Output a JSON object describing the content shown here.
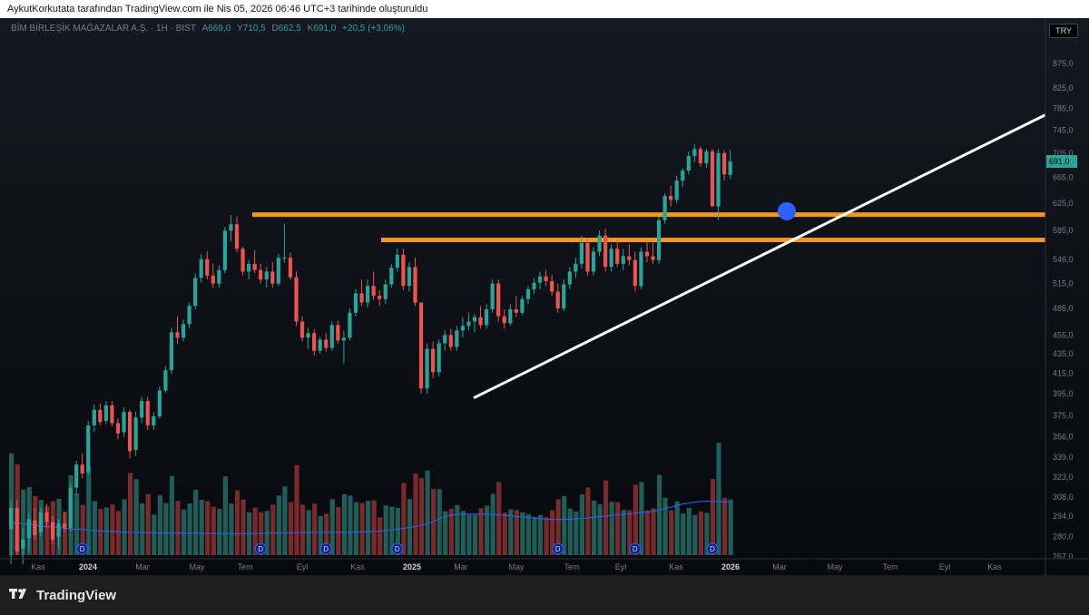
{
  "header": {
    "attribution": "AykutKorkutata tarafından TradingView.com ile Nis 05, 2026 06:46 UTC+3 tarihinde oluşturuldu"
  },
  "legend": {
    "symbol": "BİM BİRLEŞİK MAĞAZALAR A.Ş. · 1H · BIST",
    "a_label": "A",
    "a_value": "669,0",
    "y_label": "Y",
    "y_value": "710,5",
    "d_label": "D",
    "d_value": "662,5",
    "k_label": "K",
    "k_value": "691,0",
    "change": "+20,5 (+3,06%)"
  },
  "currency_badge": "TRY",
  "footer": {
    "brand": "TradingView",
    "logo_icon": "tradingview-logo-icon"
  },
  "chart_data": {
    "type": "candlestick",
    "scale": "log",
    "ylim": [
      262,
      900
    ],
    "price_ticks": [
      "875,0",
      "825,0",
      "785,0",
      "745,0",
      "705,0",
      "665,0",
      "625,0",
      "585,0",
      "546,0",
      "515,0",
      "485,0",
      "455,0",
      "435,0",
      "415,0",
      "395,0",
      "375,0",
      "356,0",
      "339,0",
      "323,0",
      "308,0",
      "294,0",
      "280,0",
      "267,0"
    ],
    "last_price_label": "691,0",
    "x_ticks": [
      "Kas",
      "2024",
      "Mar",
      "May",
      "Tem",
      "Eyl",
      "Kas",
      "2025",
      "Mar",
      "May",
      "Tem",
      "Eyl",
      "Kas",
      "2026",
      "Mar",
      "May",
      "Tem",
      "Eyl",
      "Kas"
    ],
    "candles": [
      {
        "o": 285,
        "h": 305,
        "l": 262,
        "c": 300
      },
      {
        "o": 300,
        "h": 306,
        "l": 268,
        "c": 270
      },
      {
        "o": 272,
        "h": 286,
        "l": 262,
        "c": 278
      },
      {
        "o": 279,
        "h": 296,
        "l": 270,
        "c": 292
      },
      {
        "o": 291,
        "h": 300,
        "l": 278,
        "c": 281
      },
      {
        "o": 283,
        "h": 300,
        "l": 280,
        "c": 297
      },
      {
        "o": 297,
        "h": 303,
        "l": 286,
        "c": 290
      },
      {
        "o": 290,
        "h": 294,
        "l": 275,
        "c": 278
      },
      {
        "o": 280,
        "h": 292,
        "l": 272,
        "c": 289
      },
      {
        "o": 289,
        "h": 297,
        "l": 283,
        "c": 286
      },
      {
        "o": 286,
        "h": 318,
        "l": 284,
        "c": 315
      },
      {
        "o": 315,
        "h": 336,
        "l": 310,
        "c": 333
      },
      {
        "o": 333,
        "h": 342,
        "l": 322,
        "c": 326
      },
      {
        "o": 327,
        "h": 370,
        "l": 325,
        "c": 366
      },
      {
        "o": 366,
        "h": 385,
        "l": 360,
        "c": 380
      },
      {
        "o": 380,
        "h": 386,
        "l": 366,
        "c": 369
      },
      {
        "o": 370,
        "h": 388,
        "l": 367,
        "c": 384
      },
      {
        "o": 384,
        "h": 388,
        "l": 365,
        "c": 368
      },
      {
        "o": 368,
        "h": 372,
        "l": 354,
        "c": 359
      },
      {
        "o": 360,
        "h": 382,
        "l": 356,
        "c": 378
      },
      {
        "o": 378,
        "h": 380,
        "l": 338,
        "c": 344
      },
      {
        "o": 345,
        "h": 378,
        "l": 340,
        "c": 373
      },
      {
        "o": 373,
        "h": 392,
        "l": 368,
        "c": 388
      },
      {
        "o": 388,
        "h": 392,
        "l": 362,
        "c": 366
      },
      {
        "o": 366,
        "h": 378,
        "l": 362,
        "c": 374
      },
      {
        "o": 374,
        "h": 402,
        "l": 372,
        "c": 398
      },
      {
        "o": 398,
        "h": 422,
        "l": 396,
        "c": 418
      },
      {
        "o": 418,
        "h": 463,
        "l": 414,
        "c": 458
      },
      {
        "o": 458,
        "h": 476,
        "l": 445,
        "c": 452
      },
      {
        "o": 452,
        "h": 472,
        "l": 448,
        "c": 467
      },
      {
        "o": 467,
        "h": 492,
        "l": 462,
        "c": 488
      },
      {
        "o": 488,
        "h": 528,
        "l": 484,
        "c": 522
      },
      {
        "o": 522,
        "h": 553,
        "l": 516,
        "c": 546
      },
      {
        "o": 546,
        "h": 556,
        "l": 520,
        "c": 525
      },
      {
        "o": 525,
        "h": 540,
        "l": 510,
        "c": 515
      },
      {
        "o": 515,
        "h": 538,
        "l": 510,
        "c": 532
      },
      {
        "o": 532,
        "h": 590,
        "l": 528,
        "c": 585
      },
      {
        "o": 585,
        "h": 607,
        "l": 570,
        "c": 594
      },
      {
        "o": 594,
        "h": 605,
        "l": 555,
        "c": 560
      },
      {
        "o": 560,
        "h": 563,
        "l": 525,
        "c": 530
      },
      {
        "o": 530,
        "h": 545,
        "l": 520,
        "c": 540
      },
      {
        "o": 540,
        "h": 558,
        "l": 528,
        "c": 532
      },
      {
        "o": 532,
        "h": 540,
        "l": 515,
        "c": 520
      },
      {
        "o": 520,
        "h": 536,
        "l": 510,
        "c": 530
      },
      {
        "o": 530,
        "h": 542,
        "l": 510,
        "c": 515
      },
      {
        "o": 515,
        "h": 553,
        "l": 512,
        "c": 548
      },
      {
        "o": 548,
        "h": 595,
        "l": 542,
        "c": 548
      },
      {
        "o": 548,
        "h": 555,
        "l": 520,
        "c": 523
      },
      {
        "o": 523,
        "h": 530,
        "l": 465,
        "c": 470
      },
      {
        "o": 470,
        "h": 476,
        "l": 448,
        "c": 452
      },
      {
        "o": 452,
        "h": 463,
        "l": 440,
        "c": 457
      },
      {
        "o": 457,
        "h": 461,
        "l": 433,
        "c": 438
      },
      {
        "o": 438,
        "h": 453,
        "l": 435,
        "c": 450
      },
      {
        "o": 450,
        "h": 457,
        "l": 437,
        "c": 441
      },
      {
        "o": 441,
        "h": 470,
        "l": 438,
        "c": 466
      },
      {
        "o": 466,
        "h": 471,
        "l": 445,
        "c": 449
      },
      {
        "o": 449,
        "h": 460,
        "l": 425,
        "c": 452
      },
      {
        "o": 452,
        "h": 485,
        "l": 449,
        "c": 480
      },
      {
        "o": 480,
        "h": 508,
        "l": 476,
        "c": 503
      },
      {
        "o": 503,
        "h": 520,
        "l": 488,
        "c": 492
      },
      {
        "o": 492,
        "h": 520,
        "l": 486,
        "c": 512
      },
      {
        "o": 512,
        "h": 530,
        "l": 495,
        "c": 500
      },
      {
        "o": 500,
        "h": 507,
        "l": 488,
        "c": 496
      },
      {
        "o": 496,
        "h": 520,
        "l": 490,
        "c": 514
      },
      {
        "o": 514,
        "h": 540,
        "l": 510,
        "c": 535
      },
      {
        "o": 535,
        "h": 560,
        "l": 530,
        "c": 552
      },
      {
        "o": 552,
        "h": 560,
        "l": 507,
        "c": 512
      },
      {
        "o": 512,
        "h": 542,
        "l": 505,
        "c": 536
      },
      {
        "o": 536,
        "h": 548,
        "l": 488,
        "c": 492
      },
      {
        "o": 492,
        "h": 440,
        "l": 395,
        "c": 400
      },
      {
        "o": 400,
        "h": 446,
        "l": 395,
        "c": 440
      },
      {
        "o": 440,
        "h": 448,
        "l": 410,
        "c": 416
      },
      {
        "o": 416,
        "h": 450,
        "l": 412,
        "c": 446
      },
      {
        "o": 446,
        "h": 460,
        "l": 438,
        "c": 455
      },
      {
        "o": 455,
        "h": 462,
        "l": 438,
        "c": 442
      },
      {
        "o": 442,
        "h": 465,
        "l": 438,
        "c": 460
      },
      {
        "o": 460,
        "h": 475,
        "l": 452,
        "c": 465
      },
      {
        "o": 465,
        "h": 480,
        "l": 460,
        "c": 470
      },
      {
        "o": 470,
        "h": 478,
        "l": 458,
        "c": 475
      },
      {
        "o": 475,
        "h": 488,
        "l": 462,
        "c": 466
      },
      {
        "o": 466,
        "h": 490,
        "l": 462,
        "c": 484
      },
      {
        "o": 484,
        "h": 520,
        "l": 480,
        "c": 515
      },
      {
        "o": 515,
        "h": 520,
        "l": 470,
        "c": 476
      },
      {
        "o": 476,
        "h": 484,
        "l": 462,
        "c": 468
      },
      {
        "o": 468,
        "h": 490,
        "l": 465,
        "c": 484
      },
      {
        "o": 484,
        "h": 500,
        "l": 475,
        "c": 480
      },
      {
        "o": 480,
        "h": 500,
        "l": 477,
        "c": 496
      },
      {
        "o": 496,
        "h": 512,
        "l": 490,
        "c": 508
      },
      {
        "o": 508,
        "h": 522,
        "l": 502,
        "c": 516
      },
      {
        "o": 516,
        "h": 530,
        "l": 508,
        "c": 524
      },
      {
        "o": 524,
        "h": 532,
        "l": 512,
        "c": 518
      },
      {
        "o": 518,
        "h": 526,
        "l": 500,
        "c": 505
      },
      {
        "o": 505,
        "h": 515,
        "l": 480,
        "c": 485
      },
      {
        "o": 485,
        "h": 520,
        "l": 482,
        "c": 514
      },
      {
        "o": 514,
        "h": 536,
        "l": 508,
        "c": 530
      },
      {
        "o": 530,
        "h": 548,
        "l": 522,
        "c": 540
      },
      {
        "o": 540,
        "h": 578,
        "l": 534,
        "c": 568
      },
      {
        "o": 568,
        "h": 575,
        "l": 525,
        "c": 530
      },
      {
        "o": 530,
        "h": 562,
        "l": 525,
        "c": 556
      },
      {
        "o": 556,
        "h": 585,
        "l": 550,
        "c": 578
      },
      {
        "o": 578,
        "h": 588,
        "l": 530,
        "c": 536
      },
      {
        "o": 536,
        "h": 566,
        "l": 530,
        "c": 560
      },
      {
        "o": 560,
        "h": 572,
        "l": 536,
        "c": 540
      },
      {
        "o": 540,
        "h": 560,
        "l": 532,
        "c": 550
      },
      {
        "o": 550,
        "h": 566,
        "l": 538,
        "c": 545
      },
      {
        "o": 545,
        "h": 556,
        "l": 505,
        "c": 512
      },
      {
        "o": 512,
        "h": 562,
        "l": 508,
        "c": 556
      },
      {
        "o": 556,
        "h": 570,
        "l": 542,
        "c": 550
      },
      {
        "o": 550,
        "h": 570,
        "l": 540,
        "c": 545
      },
      {
        "o": 545,
        "h": 605,
        "l": 540,
        "c": 600
      },
      {
        "o": 600,
        "h": 640,
        "l": 595,
        "c": 636
      },
      {
        "o": 636,
        "h": 652,
        "l": 620,
        "c": 630
      },
      {
        "o": 630,
        "h": 668,
        "l": 625,
        "c": 660
      },
      {
        "o": 660,
        "h": 680,
        "l": 650,
        "c": 676
      },
      {
        "o": 676,
        "h": 708,
        "l": 670,
        "c": 700
      },
      {
        "o": 700,
        "h": 720,
        "l": 690,
        "c": 712
      },
      {
        "o": 712,
        "h": 716,
        "l": 682,
        "c": 688
      },
      {
        "o": 688,
        "h": 712,
        "l": 680,
        "c": 708
      },
      {
        "o": 708,
        "h": 712,
        "l": 640,
        "c": 620
      },
      {
        "o": 620,
        "h": 712,
        "l": 600,
        "c": 705
      },
      {
        "o": 705,
        "h": 710,
        "l": 660,
        "c": 670
      },
      {
        "o": 669,
        "h": 710,
        "l": 662,
        "c": 691
      }
    ],
    "volume_ma": [
      1.6,
      1.6,
      1.55,
      1.5,
      1.45,
      1.42,
      1.38,
      1.34,
      1.3,
      1.28,
      1.25,
      1.22,
      1.2,
      1.18,
      1.15,
      1.14,
      1.13,
      1.12,
      1.12,
      1.11,
      1.11,
      1.1,
      1.1,
      1.1,
      1.09,
      1.09,
      1.08,
      1.08,
      1.08,
      1.08,
      1.08,
      1.09,
      1.1,
      1.1,
      1.12,
      1.12,
      1.13,
      1.13,
      1.14,
      1.14,
      1.15,
      1.15,
      1.15,
      1.16,
      1.17,
      1.18,
      1.2,
      1.24,
      1.28,
      1.34,
      1.4,
      1.46,
      1.55,
      1.7,
      1.88,
      2.0,
      2.04,
      2.06,
      2.06,
      2.05,
      2.04,
      2.02,
      1.99,
      1.95,
      1.92,
      1.88,
      1.84,
      1.8,
      1.78,
      1.78,
      1.8,
      1.83,
      1.86,
      1.9,
      1.94,
      1.98,
      2.02,
      2.06,
      2.1,
      2.14,
      2.18,
      2.25,
      2.35,
      2.45,
      2.55,
      2.62,
      2.68,
      2.7,
      2.7,
      2.68,
      2.65
    ]
  }
}
